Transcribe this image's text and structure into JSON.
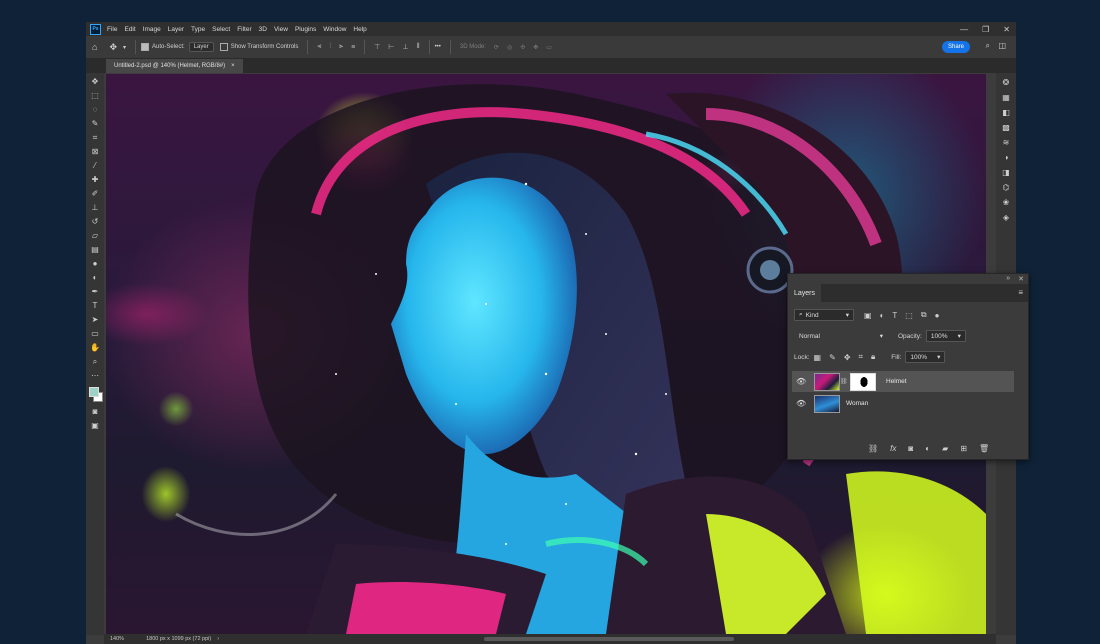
{
  "app": {
    "logo": "Ps",
    "menu": [
      "File",
      "Edit",
      "Image",
      "Layer",
      "Type",
      "Select",
      "Filter",
      "3D",
      "View",
      "Plugins",
      "Window",
      "Help"
    ],
    "window_controls": {
      "minimize": "—",
      "maximize": "❐",
      "close": "✕"
    }
  },
  "options_bar": {
    "auto_select_label": "Auto-Select:",
    "auto_select_checked": true,
    "auto_select_target": "Layer",
    "show_transform_label": "Show Transform Controls",
    "show_transform_checked": false,
    "three_d_mode_label": "3D Mode:",
    "more_label": "•••",
    "share_label": "Share"
  },
  "document": {
    "tab_title": "Untitled-2.psd @ 140% (Helmet, RGB/8#)",
    "tab_close": "×"
  },
  "status_bar": {
    "zoom": "140%",
    "doc_size": "1800 px x 1099 px (72 ppi)",
    "arrow": "›"
  },
  "colors": {
    "foreground": "#9ed1c6",
    "background": "#ffffff",
    "accent": "#1473e6"
  },
  "layers_panel": {
    "title": "Layers",
    "filter_label": "Kind",
    "blend_mode": "Normal",
    "opacity_label": "Opacity:",
    "opacity_value": "100%",
    "lock_label": "Lock:",
    "fill_label": "Fill:",
    "fill_value": "100%",
    "layers": [
      {
        "name": "Helmet",
        "visible": true,
        "selected": true,
        "has_mask": true
      },
      {
        "name": "Woman",
        "visible": true,
        "selected": false,
        "has_mask": false
      }
    ]
  }
}
